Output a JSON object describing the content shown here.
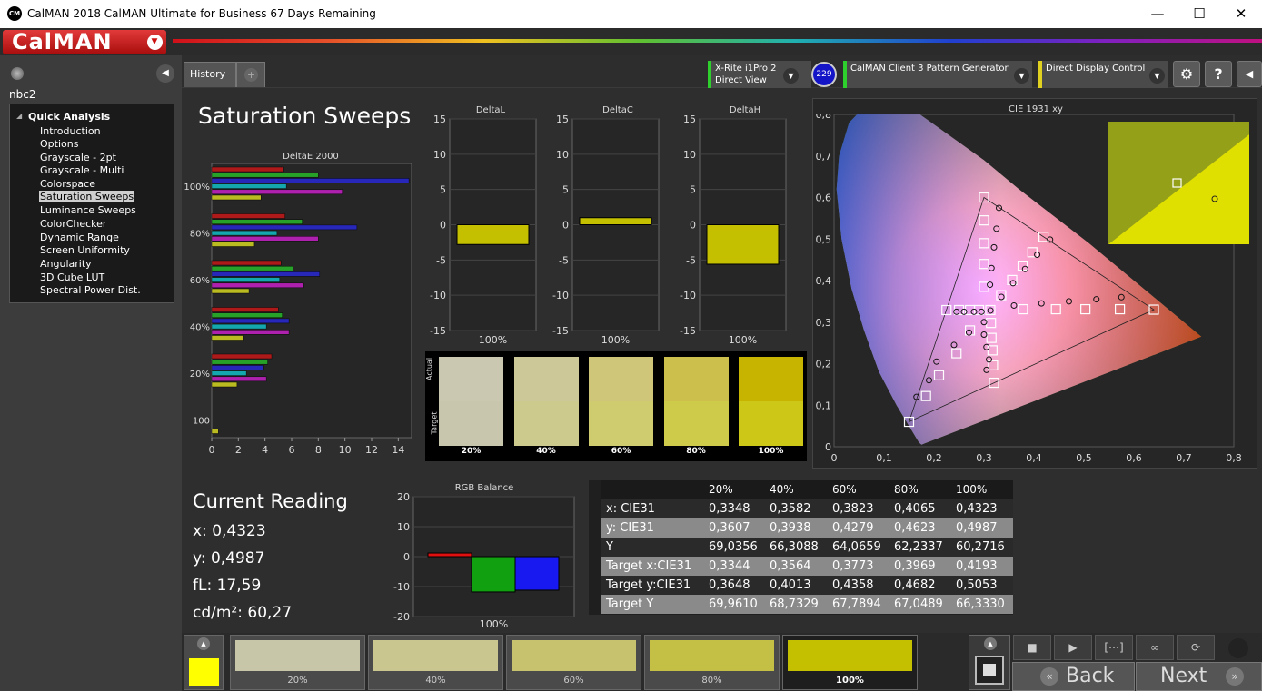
{
  "window": {
    "title": "CalMAN 2018 CalMAN Ultimate for Business 67 Days Remaining",
    "icon": "CM",
    "minimize": "—",
    "maximize": "☐",
    "close": "✕"
  },
  "brand": {
    "logo": "CalMAN",
    "colors": {
      "logo": "#c41818",
      "accent": "#2dd02d"
    }
  },
  "sidebar": {
    "profile": "nbc2",
    "group": "Quick Analysis",
    "items": [
      "Introduction",
      "Options",
      "Grayscale - 2pt",
      "Grayscale - Multi",
      "Colorspace",
      "Saturation Sweeps",
      "Luminance Sweeps",
      "ColorChecker",
      "Dynamic Range",
      "Screen Uniformity",
      "Angularity",
      "3D Cube LUT",
      "Spectral Power Dist."
    ],
    "selected": "Saturation Sweeps"
  },
  "tabs": {
    "history": "History 1",
    "add": "+"
  },
  "devices": {
    "meter": {
      "line1": "X-Rite i1Pro 2",
      "line2": "Direct View",
      "badge": "229"
    },
    "generator": {
      "label": "CalMAN Client 3 Pattern Generator"
    },
    "display": {
      "label": "Direct Display Control"
    }
  },
  "toolbar": {
    "settings": "⚙",
    "help": "?",
    "collapse": "◀"
  },
  "page": {
    "title": "Saturation Sweeps"
  },
  "charts": {
    "deltae_title": "DeltaE 2000",
    "deltal_title": "DeltaL",
    "deltac_title": "DeltaC",
    "deltah_title": "DeltaH",
    "cie_title": "CIE 1931 xy",
    "rgb_title": "RGB Balance",
    "swatch_actual": "Actual",
    "swatch_target": "Target"
  },
  "chart_data": [
    {
      "type": "bar",
      "title": "DeltaE 2000",
      "orientation": "horizontal",
      "categories": [
        "100%",
        "80%",
        "60%",
        "40%",
        "20%",
        "100"
      ],
      "xlim": [
        0,
        15
      ],
      "xticks": [
        0,
        2,
        4,
        6,
        8,
        10,
        12,
        14
      ],
      "series": [
        {
          "color": "#d01818",
          "values": [
            5.4,
            5.5,
            5.2,
            5.0,
            4.5,
            0
          ]
        },
        {
          "color": "#28c028",
          "values": [
            8.0,
            6.8,
            6.1,
            5.3,
            4.2,
            0
          ]
        },
        {
          "color": "#2828e0",
          "values": [
            14.8,
            10.9,
            8.1,
            5.8,
            3.9,
            0
          ]
        },
        {
          "color": "#10c8d0",
          "values": [
            5.6,
            4.9,
            5.1,
            4.1,
            2.6,
            0
          ]
        },
        {
          "color": "#d020d0",
          "values": [
            9.8,
            8.0,
            6.9,
            5.8,
            4.1,
            0
          ]
        },
        {
          "color": "#e0e020",
          "values": [
            3.7,
            3.2,
            2.8,
            2.4,
            1.9,
            0.5
          ]
        }
      ]
    },
    {
      "type": "bar",
      "title": "DeltaL",
      "categories": [
        "100%"
      ],
      "values": [
        -2.8
      ],
      "ylim": [
        -15,
        15
      ],
      "yticks": [
        15,
        10,
        5,
        0,
        -5,
        -10,
        -15
      ]
    },
    {
      "type": "bar",
      "title": "DeltaC",
      "categories": [
        "100%"
      ],
      "values": [
        1.0
      ],
      "ylim": [
        -15,
        15
      ],
      "yticks": [
        15,
        10,
        5,
        0,
        -5,
        -10,
        -15
      ]
    },
    {
      "type": "bar",
      "title": "DeltaH",
      "categories": [
        "100%"
      ],
      "values": [
        -5.6
      ],
      "ylim": [
        -15,
        15
      ],
      "yticks": [
        15,
        10,
        5,
        0,
        -5,
        -10,
        -15
      ]
    },
    {
      "type": "bar",
      "title": "RGB Balance",
      "categories": [
        "100%"
      ],
      "series": [
        {
          "color": "#e01010",
          "values": [
            1.2
          ]
        },
        {
          "color": "#10a010",
          "values": [
            -11.8
          ]
        },
        {
          "color": "#1818f0",
          "values": [
            -11.2
          ]
        }
      ],
      "ylim": [
        -20,
        20
      ],
      "yticks": [
        20,
        10,
        0,
        -10,
        -20
      ]
    },
    {
      "type": "scatter",
      "title": "CIE 1931 xy",
      "xlim": [
        0,
        0.8
      ],
      "ylim": [
        0,
        0.8
      ],
      "xticks": [
        "0",
        "0,1",
        "0,2",
        "0,3",
        "0,4",
        "0,5",
        "0,6",
        "0,7",
        "0,8"
      ],
      "yticks": [
        "0",
        "0,1",
        "0,2",
        "0,3",
        "0,4",
        "0,5",
        "0,6",
        "0,7",
        "0,8"
      ],
      "targets": [
        [
          0.64,
          0.33
        ],
        [
          0.572,
          0.331
        ],
        [
          0.503,
          0.331
        ],
        [
          0.444,
          0.331
        ],
        [
          0.378,
          0.331
        ],
        [
          0.3,
          0.6
        ],
        [
          0.3,
          0.545
        ],
        [
          0.3,
          0.49
        ],
        [
          0.3,
          0.44
        ],
        [
          0.3,
          0.385
        ],
        [
          0.15,
          0.06
        ],
        [
          0.184,
          0.122
        ],
        [
          0.21,
          0.172
        ],
        [
          0.245,
          0.225
        ],
        [
          0.272,
          0.28
        ],
        [
          0.225,
          0.329
        ],
        [
          0.25,
          0.329
        ],
        [
          0.272,
          0.329
        ],
        [
          0.29,
          0.329
        ],
        [
          0.3127,
          0.329
        ],
        [
          0.32,
          0.154
        ],
        [
          0.318,
          0.196
        ],
        [
          0.317,
          0.232
        ],
        [
          0.315,
          0.262
        ],
        [
          0.314,
          0.298
        ],
        [
          0.4193,
          0.5053
        ],
        [
          0.3969,
          0.4682
        ],
        [
          0.3773,
          0.4358
        ],
        [
          0.3564,
          0.4013
        ],
        [
          0.3344,
          0.3648
        ]
      ],
      "measured": [
        [
          0.575,
          0.36
        ],
        [
          0.525,
          0.355
        ],
        [
          0.47,
          0.35
        ],
        [
          0.415,
          0.345
        ],
        [
          0.36,
          0.34
        ],
        [
          0.33,
          0.575
        ],
        [
          0.325,
          0.525
        ],
        [
          0.32,
          0.48
        ],
        [
          0.315,
          0.43
        ],
        [
          0.312,
          0.39
        ],
        [
          0.165,
          0.12
        ],
        [
          0.19,
          0.16
        ],
        [
          0.205,
          0.205
        ],
        [
          0.24,
          0.245
        ],
        [
          0.27,
          0.275
        ],
        [
          0.245,
          0.325
        ],
        [
          0.26,
          0.325
        ],
        [
          0.28,
          0.325
        ],
        [
          0.295,
          0.325
        ],
        [
          0.313,
          0.328
        ],
        [
          0.305,
          0.185
        ],
        [
          0.31,
          0.21
        ],
        [
          0.305,
          0.24
        ],
        [
          0.3,
          0.27
        ],
        [
          0.3,
          0.3
        ],
        [
          0.4323,
          0.4987
        ],
        [
          0.4065,
          0.4623
        ],
        [
          0.3823,
          0.4279
        ],
        [
          0.3582,
          0.3938
        ],
        [
          0.3348,
          0.3607
        ]
      ]
    },
    {
      "type": "table",
      "columns": [
        "20%",
        "40%",
        "60%",
        "80%",
        "100%"
      ],
      "rows": [
        {
          "label": "x: CIE31",
          "values": [
            "0,3348",
            "0,3582",
            "0,3823",
            "0,4065",
            "0,4323"
          ]
        },
        {
          "label": "y: CIE31",
          "values": [
            "0,3607",
            "0,3938",
            "0,4279",
            "0,4623",
            "0,4987"
          ]
        },
        {
          "label": "Y",
          "values": [
            "69,0356",
            "66,3088",
            "64,0659",
            "62,2337",
            "60,2716"
          ]
        },
        {
          "label": "Target x:CIE31",
          "values": [
            "0,3344",
            "0,3564",
            "0,3773",
            "0,3969",
            "0,4193"
          ]
        },
        {
          "label": "Target y:CIE31",
          "values": [
            "0,3648",
            "0,4013",
            "0,4358",
            "0,4682",
            "0,5053"
          ]
        },
        {
          "label": "Target Y",
          "values": [
            "69,9610",
            "68,7329",
            "67,7894",
            "67,0489",
            "66,3330"
          ]
        }
      ]
    }
  ],
  "swatches": [
    {
      "label": "20%",
      "actual": "#cac8b0",
      "target": "#c8c6ac"
    },
    {
      "label": "40%",
      "actual": "#ccc898",
      "target": "#cdca8e"
    },
    {
      "label": "60%",
      "actual": "#cfc67a",
      "target": "#cfcc70"
    },
    {
      "label": "80%",
      "actual": "#cdbf4c",
      "target": "#cfcb4a"
    },
    {
      "label": "100%",
      "actual": "#c6b400",
      "target": "#cdc818"
    }
  ],
  "current_reading": {
    "title": "Current Reading",
    "x": "x: 0,4323",
    "y": "y: 0,4987",
    "fl": "fL: 17,59",
    "cd": "cd/m²: 60,27"
  },
  "bottom": {
    "swatch_color": "#ffff00",
    "steps": [
      {
        "label": "20%",
        "color": "#c7c6a8"
      },
      {
        "label": "40%",
        "color": "#c9c78f"
      },
      {
        "label": "60%",
        "color": "#c6c26e"
      },
      {
        "label": "80%",
        "color": "#c4c046"
      },
      {
        "label": "100%",
        "color": "#c4c000"
      }
    ],
    "back": "Back",
    "next": "Next"
  }
}
